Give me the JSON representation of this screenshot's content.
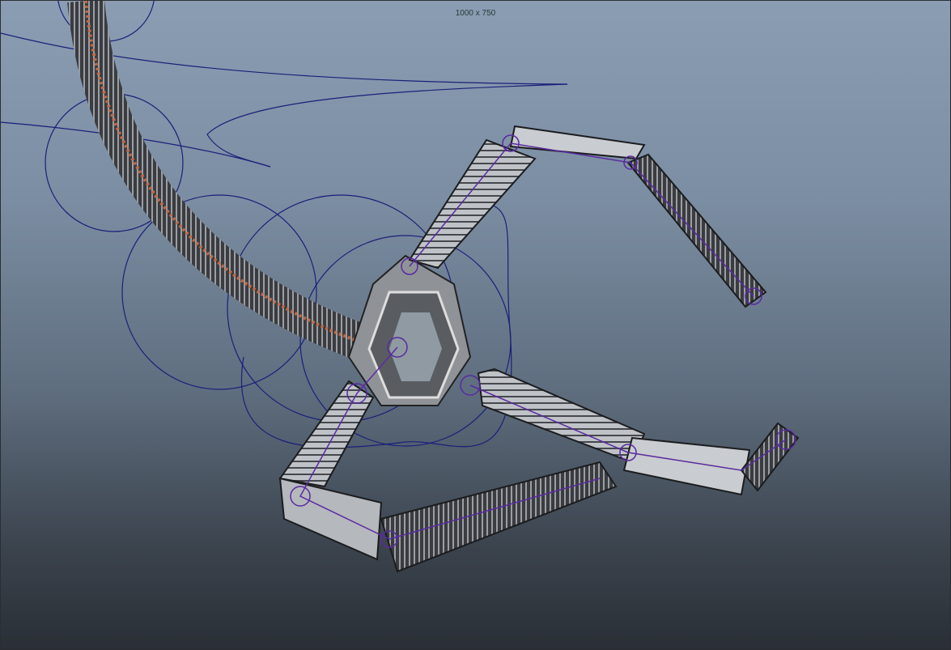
{
  "viewport": {
    "resolution_gate_label": "1000 x 750",
    "colors": {
      "curve": "#1a1f7a",
      "rig": "#5a2aa0",
      "spine": "#c06a48",
      "mesh": "#cfd3d8"
    }
  }
}
